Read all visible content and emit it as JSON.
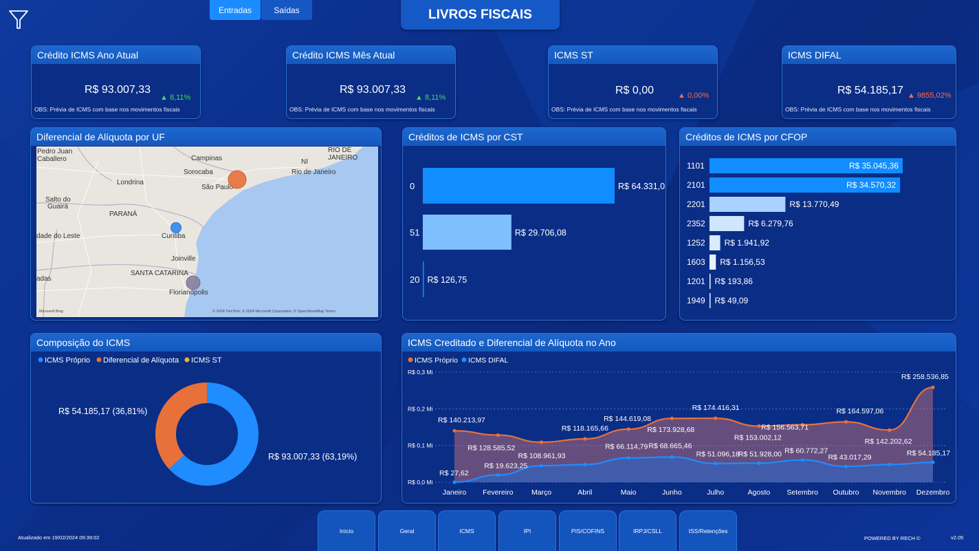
{
  "header": {
    "title": "LIVROS FISCAIS",
    "tabs": [
      {
        "label": "Entradas",
        "active": true
      },
      {
        "label": "Saídas",
        "active": false
      }
    ],
    "filter_icon": "funnel-icon"
  },
  "kpis": [
    {
      "title": "Crédito ICMS Ano Atual",
      "value": "R$ 93.007,33",
      "delta": "▲ 8,11%",
      "trend": "up",
      "obs": "OBS: Prévia de ICMS com base nos movimentos fiscais"
    },
    {
      "title": "Crédito ICMS Mês Atual",
      "value": "R$ 93.007,33",
      "delta": "▲ 8,11%",
      "trend": "up",
      "obs": "OBS: Prévia de ICMS com base nos movimentos fiscais"
    },
    {
      "title": "ICMS ST",
      "value": "R$ 0,00",
      "delta": "▲ 0,00%",
      "trend": "warn",
      "obs": "OBS: Prévia de ICMS com base nos movimentos fiscais"
    },
    {
      "title": "ICMS DIFAL",
      "value": "R$ 54.185,17",
      "delta": "▲ 9855,02%",
      "trend": "warn",
      "obs": "OBS: Prévia de ICMS com base nos movimentos fiscais"
    }
  ],
  "map": {
    "title": "Diferencial de Alíquota por UF",
    "labels": [
      "Pedro Juan",
      "Caballero",
      "Campinas",
      "RIO DE",
      "JANEIRO",
      "NI",
      "Rio de Janeiro",
      "Sorocaba",
      "São Paulo",
      "Londrina",
      "Salto do",
      "Guairá",
      "PARANÁ",
      "Curitiba",
      "dade do Leste",
      "Joinville",
      "SANTA CATARINA",
      "Florianópolis",
      "adas"
    ],
    "credits": "© 2024 TomTom, © 2024 Microsoft Corporation, © OpenStreetMap  Terms",
    "brand": "Microsoft Bing"
  },
  "cst": {
    "title": "Créditos de ICMS por CST",
    "chart_data": {
      "type": "bar",
      "orientation": "horizontal",
      "categories": [
        "0",
        "51",
        "20"
      ],
      "values": [
        64331.03,
        29706.08,
        126.75
      ],
      "data_labels": [
        "R$ 64.331,03",
        "R$ 29.706,08",
        "R$ 126,75"
      ],
      "colors": [
        "#118dff",
        "#7ec0ff",
        "#118dff"
      ]
    }
  },
  "cfop": {
    "title": "Créditos de ICMS por CFOP",
    "chart_data": {
      "type": "bar",
      "orientation": "horizontal",
      "categories": [
        "1101",
        "2101",
        "2201",
        "2352",
        "1252",
        "1603",
        "1201",
        "1949"
      ],
      "values": [
        35045.36,
        34570.32,
        13770.49,
        6279.76,
        1941.92,
        1156.53,
        193.86,
        49.09
      ],
      "data_labels": [
        "R$ 35.045,36",
        "R$ 34.570,32",
        "R$ 13.770,49",
        "R$ 6.279,76",
        "R$ 1.941,92",
        "R$ 1.156,53",
        "R$ 193,86",
        "R$ 49,09"
      ]
    }
  },
  "composition": {
    "title": "Composição do ICMS",
    "chart_data": {
      "type": "pie",
      "donut": true,
      "legend": [
        {
          "name": "ICMS Próprio",
          "color": "#1f8cff"
        },
        {
          "name": "Diferencial de Alíquota",
          "color": "#e8703a"
        },
        {
          "name": "ICMS ST",
          "color": "#e5b829"
        }
      ],
      "slices": [
        {
          "name": "ICMS Próprio",
          "value": 93007.33,
          "percent": 63.19,
          "label": "R$ 93.007,33 (63,19%)",
          "color": "#1f8cff"
        },
        {
          "name": "Diferencial de Alíquota",
          "value": 54185.17,
          "percent": 36.81,
          "label": "R$ 54.185,17 (36,81%)",
          "color": "#e8703a"
        }
      ]
    }
  },
  "yearly": {
    "title": "ICMS Creditado e Diferencial de Alíquota no Ano",
    "chart_data": {
      "type": "area",
      "x": [
        "Janeiro",
        "Fevereiro",
        "Março",
        "Abril",
        "Maio",
        "Junho",
        "Julho",
        "Agosto",
        "Setembro",
        "Outubro",
        "Novembro",
        "Dezembro"
      ],
      "yticks": [
        "R$ 0,0 Mi",
        "R$ 0,1 Mi",
        "R$ 0,2 Mi",
        "R$ 0,3 Mi"
      ],
      "ylim": [
        0,
        300000
      ],
      "series": [
        {
          "name": "ICMS Próprio",
          "color": "#e8703a",
          "values": [
            140213.97,
            128585.52,
            108961.93,
            118165.66,
            144619.08,
            173928.68,
            174416.31,
            153002.12,
            156563.71,
            164597.06,
            142202.62,
            258536.85
          ],
          "labels": [
            "R$ 140.213,97",
            "R$ 128.585,52",
            "R$ 108.961,93",
            "R$ 118.165,66",
            "R$ 144.619,08",
            "R$ 173.928,68",
            "R$ 174.416,31",
            "R$ 153.002,12",
            "R$ 156.563,71",
            "R$ 164.597,06",
            "R$ 142.202,62",
            "R$ 258.536,85"
          ]
        },
        {
          "name": "ICMS DIFAL",
          "color": "#1f8cff",
          "values": [
            27.62,
            19623.25,
            45000,
            48000,
            66114.79,
            68665.46,
            51096.18,
            51928.0,
            60772.27,
            43017.29,
            48000,
            54185.17
          ],
          "labels": [
            "R$ 27,62",
            "R$ 19.623,25",
            "",
            "",
            "R$ 66.114,79",
            "R$ 68.665,46",
            "R$ 51.096,18",
            "R$ 51.928,00",
            "R$ 60.772,27",
            "R$ 43.017,29",
            "",
            "R$ 54.185,17"
          ]
        }
      ]
    }
  },
  "nav": [
    "Início",
    "Geral",
    "ICMS",
    "IPI",
    "PIS/COFINS",
    "IRPJ/CSLL",
    "ISS/Retenções"
  ],
  "footer": {
    "updated": "Atualizado em 19/02/2024 09:39:02",
    "powered": "POWERED BY RECH ©",
    "version": "v2.05"
  }
}
